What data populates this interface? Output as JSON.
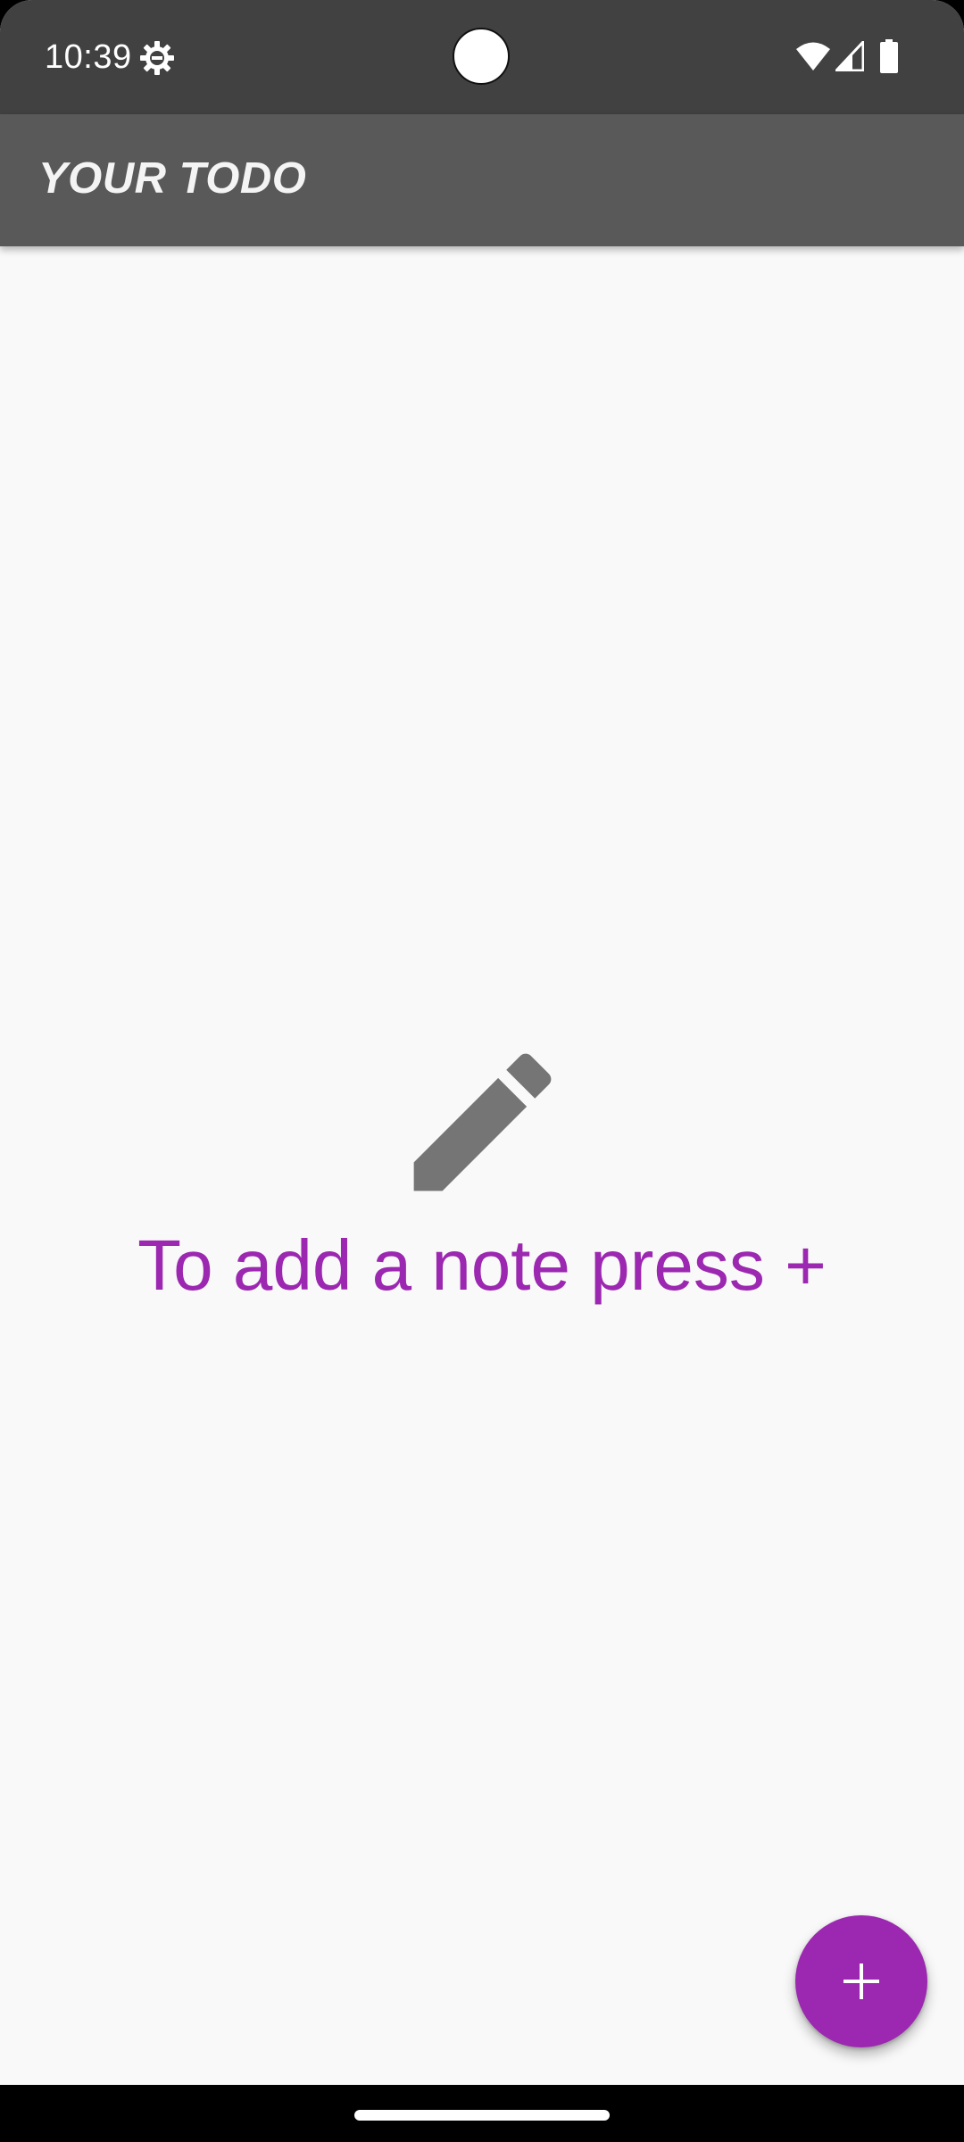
{
  "status_bar": {
    "time": "10:39",
    "icons": {
      "settings": "gear-icon",
      "wifi": "wifi-icon",
      "signal": "signal-icon",
      "battery": "battery-icon"
    }
  },
  "app_bar": {
    "title": "YOUR TODO"
  },
  "empty_state": {
    "icon": "pencil-icon",
    "message": "To add a note press +"
  },
  "fab": {
    "icon": "plus-icon",
    "color": "#9c27b0"
  },
  "colors": {
    "accent": "#9c27b0",
    "status_bar": "#414141",
    "app_bar": "#595959",
    "background": "#f9f9f9",
    "icon_gray": "#757575"
  }
}
